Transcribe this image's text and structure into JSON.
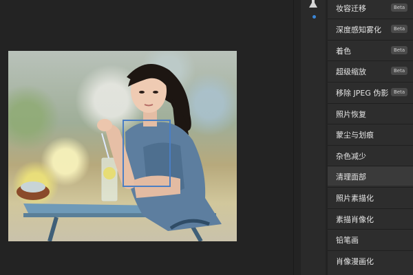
{
  "filters": [
    {
      "label": "妆容迁移",
      "badge": "Beta"
    },
    {
      "label": "深度感知雾化",
      "badge": "Beta"
    },
    {
      "label": "着色",
      "badge": "Beta"
    },
    {
      "label": "超级缩放",
      "badge": "Beta"
    },
    {
      "label": "移除 JPEG 伪影",
      "badge": "Beta"
    },
    {
      "label": "照片恢复",
      "badge": ""
    },
    {
      "label": "蒙尘与划痕",
      "badge": ""
    },
    {
      "label": "杂色减少",
      "badge": ""
    },
    {
      "label": "清理面部",
      "badge": "",
      "active": true
    },
    {
      "label": "照片素描化",
      "badge": ""
    },
    {
      "label": "素描肖像化",
      "badge": ""
    },
    {
      "label": "铅笔画",
      "badge": ""
    },
    {
      "label": "肖像漫画化",
      "badge": ""
    }
  ],
  "tools": {
    "flask_icon": "flask-icon",
    "dot_indicator": "active-dot"
  },
  "colors": {
    "face_box": "#4a7ec4",
    "panel_bg": "#2d2d2d",
    "active_item_bg": "#3a3a3a",
    "accent_dot": "#3b86d6"
  }
}
